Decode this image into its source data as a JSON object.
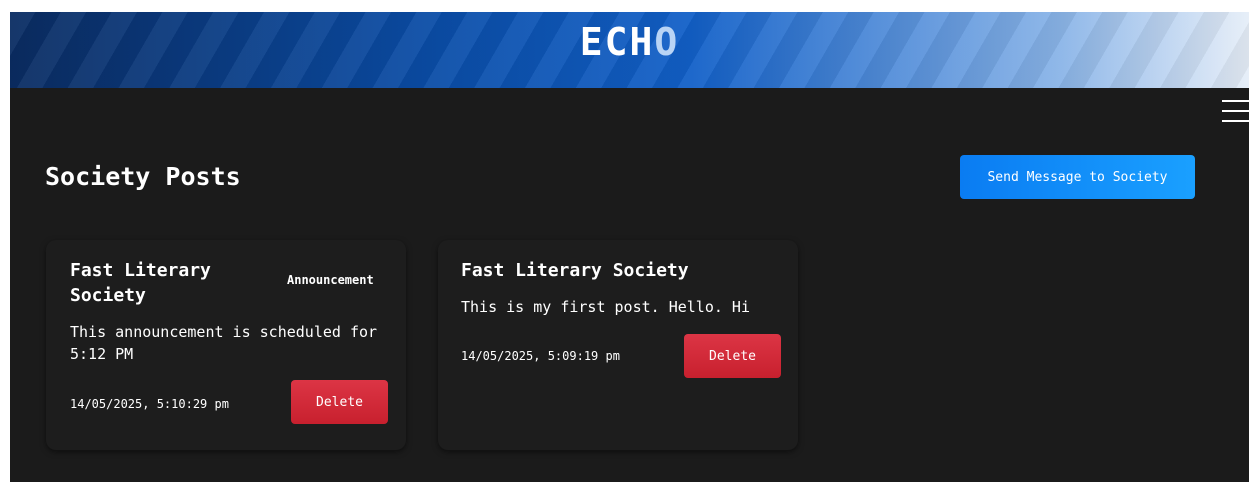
{
  "header": {
    "logo_main": "ECH",
    "logo_accent": "O"
  },
  "section_title": "Society Posts",
  "send_button_label": "Send Message to Society",
  "posts": [
    {
      "title": "Fast Literary Society",
      "badge": "Announcement",
      "body": "This announcement is scheduled for 5:12 PM",
      "timestamp": "14/05/2025, 5:10:29 pm",
      "delete_label": "Delete"
    },
    {
      "title": "Fast Literary Society",
      "body": "This is my first post. Hello. Hi",
      "timestamp": "14/05/2025, 5:09:19 pm",
      "delete_label": "Delete"
    }
  ],
  "colors": {
    "background": "#1b1b1b",
    "primary_button": "#0a7cf2",
    "danger_button": "#dc3545"
  },
  "icons": {
    "menu": "hamburger-menu-icon"
  }
}
